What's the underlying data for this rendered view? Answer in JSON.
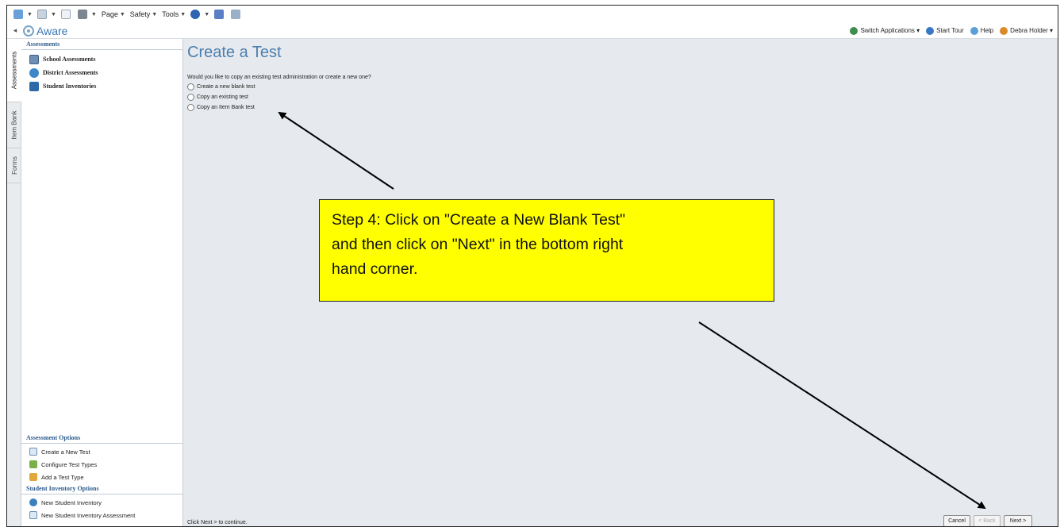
{
  "ie_toolbar": {
    "page_label": "Page",
    "safety_label": "Safety",
    "tools_label": "Tools"
  },
  "app": {
    "logo_text": "Aware"
  },
  "header_right": {
    "switch_apps": "Switch Applications",
    "start_tour": "Start Tour",
    "help": "Help",
    "user": "Debra Holder"
  },
  "vertical_tabs": [
    {
      "label": "Assessments",
      "active": true
    },
    {
      "label": "Item Bank",
      "active": false
    },
    {
      "label": "Forms",
      "active": false
    }
  ],
  "sidebar": {
    "section_title": "Assessments",
    "items": [
      {
        "label": "School Assessments",
        "icon": "grid-icon"
      },
      {
        "label": "District Assessments",
        "icon": "globe-icon"
      },
      {
        "label": "Student Inventories",
        "icon": "book-icon"
      }
    ],
    "assessment_options_title": "Assessment Options",
    "assessment_options": [
      {
        "label": "Create a New Test",
        "icon": "new-test-icon"
      },
      {
        "label": "Configure Test Types",
        "icon": "wrench-icon"
      },
      {
        "label": "Add a Test Type",
        "icon": "add-icon"
      }
    ],
    "student_options_title": "Student Inventory Options",
    "student_options": [
      {
        "label": "New Student Inventory",
        "icon": "inventory-icon"
      },
      {
        "label": "New Student Inventory Assessment",
        "icon": "new-test-icon"
      }
    ]
  },
  "main": {
    "title": "Create a Test",
    "question": "Would you like to copy an existing test administration or create a new one?",
    "options": [
      {
        "label": "Create a new blank test",
        "selected": false
      },
      {
        "label": "Copy an existing test",
        "selected": false
      },
      {
        "label": "Copy an Item Bank test",
        "selected": false
      }
    ],
    "footer_hint": "Click Next > to continue.",
    "buttons": {
      "cancel": "Cancel",
      "back": "< Back",
      "next": "Next >"
    }
  },
  "callout": {
    "line1": "Step 4: Click on \"Create a New Blank Test\"",
    "line2": "and then click on \"Next\" in the bottom right",
    "line3": "hand corner.",
    "background": "#ffff00"
  }
}
